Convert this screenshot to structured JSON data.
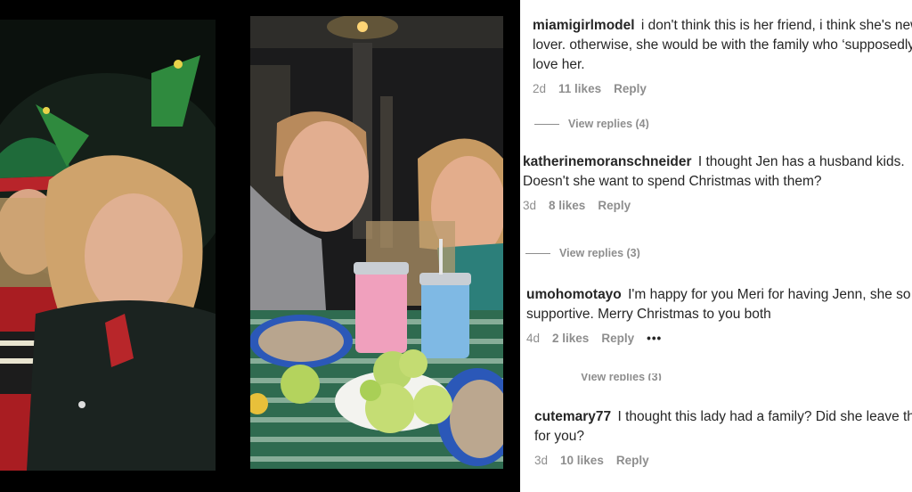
{
  "comments": [
    {
      "username": "miamigirlmodel",
      "text": "i don't think this is her friend, i think she's new lover. otherwise, she would be with the family who ‘supposedly’ love her.",
      "age": "2d",
      "likes": "11 likes",
      "reply": "Reply",
      "view_replies": "View replies (4)"
    },
    {
      "username": "katherinemoranschneider",
      "text": "I thought Jen has a husband kids. Doesn't she want to spend Christmas with them?",
      "age": "3d",
      "likes": "8 likes",
      "reply": "Reply",
      "view_replies": "View replies (3)"
    },
    {
      "username": "umohomotayo",
      "text": "I'm happy for you Meri for having Jenn, she so supportive. Merry Christmas to you both",
      "age": "4d",
      "likes": "2 likes",
      "reply": "Reply",
      "more": "•••",
      "view_replies": "View replies (3)"
    },
    {
      "username": "cutemary77",
      "text": "I thought this lady had a family? Did she leave them for you?",
      "age": "3d",
      "likes": "10 likes",
      "reply": "Reply"
    }
  ],
  "colors": {
    "text": "#262626",
    "muted": "#8e8e8e",
    "background": "#ffffff",
    "page": "#000000"
  }
}
